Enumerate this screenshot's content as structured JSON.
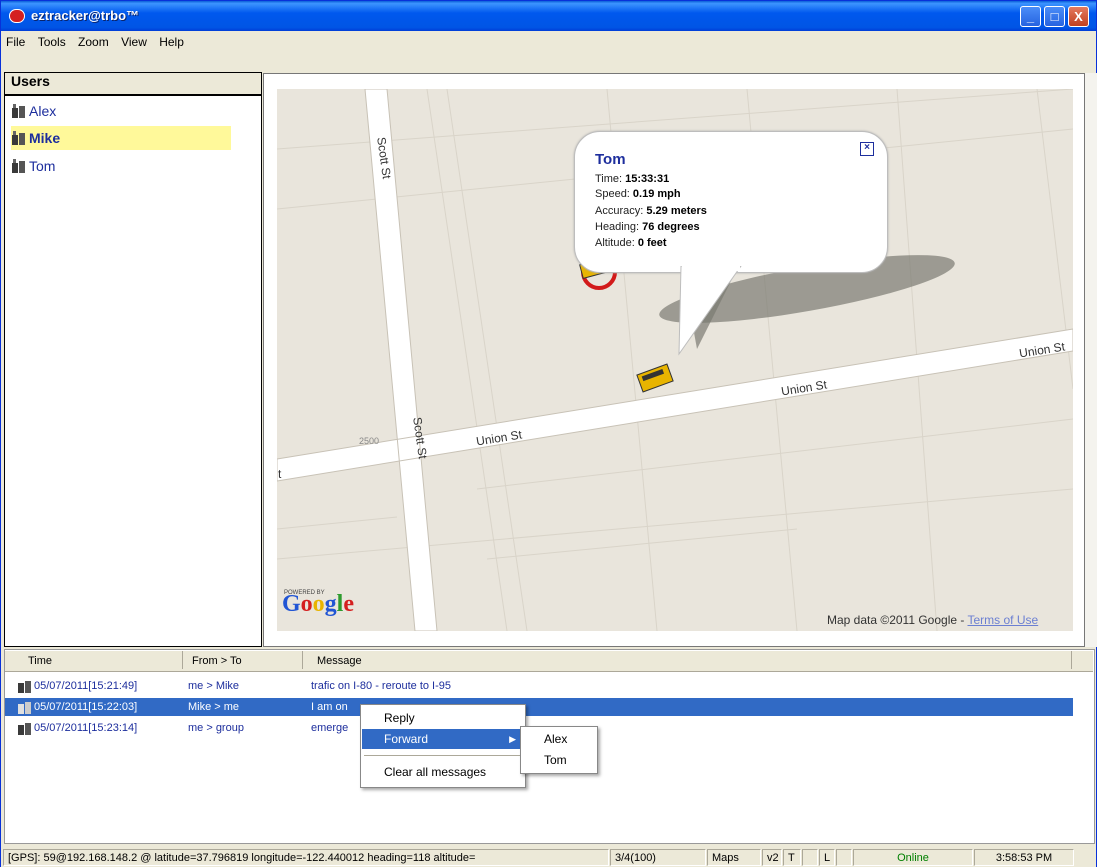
{
  "window": {
    "title": "eztracker@trbo™",
    "min_label": "_",
    "max_label": "□",
    "close_label": "X"
  },
  "menu": [
    "File",
    "Tools",
    "Zoom",
    "View",
    "Help"
  ],
  "users": {
    "header": "Users",
    "items": [
      {
        "name": "Alex",
        "selected": false
      },
      {
        "name": "Mike",
        "selected": true
      },
      {
        "name": "Tom",
        "selected": false
      }
    ]
  },
  "map": {
    "streets": {
      "scott_top": "Scott St",
      "scott_bottom": "Scott St",
      "union_left": "Union St",
      "union_mid": "Union St",
      "union_right": "Union St",
      "addr": "2500",
      "edge": "t"
    },
    "powered_by": "POWERED BY",
    "google": "Google",
    "attribution": "Map data ©2011 Google - ",
    "terms": "Terms of Use",
    "balloon": {
      "title": "Tom",
      "close": "×",
      "time_label": "Time: ",
      "time": "15:33:31",
      "speed_label": "Speed: ",
      "speed": "0.19 mph",
      "accuracy_label": "Accuracy: ",
      "accuracy": "5.29 meters",
      "heading_label": "Heading: ",
      "heading": "76 degrees",
      "altitude_label": "Altitude: ",
      "altitude": "0 feet"
    }
  },
  "messages": {
    "columns": [
      "Time",
      "From > To",
      "Message"
    ],
    "rows": [
      {
        "time": "05/07/2011[15:21:49]",
        "from_to": "me > Mike",
        "message": "trafic on I-80 - reroute to I-95"
      },
      {
        "time": "05/07/2011[15:22:03]",
        "from_to": "Mike > me",
        "message": "I am on"
      },
      {
        "time": "05/07/2011[15:23:14]",
        "from_to": "me > group",
        "message": "emerge"
      }
    ]
  },
  "context_menu": {
    "items": [
      "Reply",
      "Forward",
      "Clear all messages"
    ],
    "submenu": [
      "Alex",
      "Tom"
    ]
  },
  "statusbar": {
    "gps": "[GPS]: 59@192.168.148.2 @ latitude=37.796819 longitude=-122.440012 heading=118 altitude=",
    "count": "3/4(100)",
    "maps": "Maps",
    "v2": "v2",
    "t": "T",
    "l": "L",
    "online": "Online",
    "clock": "3:58:53 PM"
  },
  "colors": {
    "online": "#008000",
    "link": "#1d2e9d",
    "selection": "#316ac5",
    "highlight_user": "#fff99a"
  }
}
